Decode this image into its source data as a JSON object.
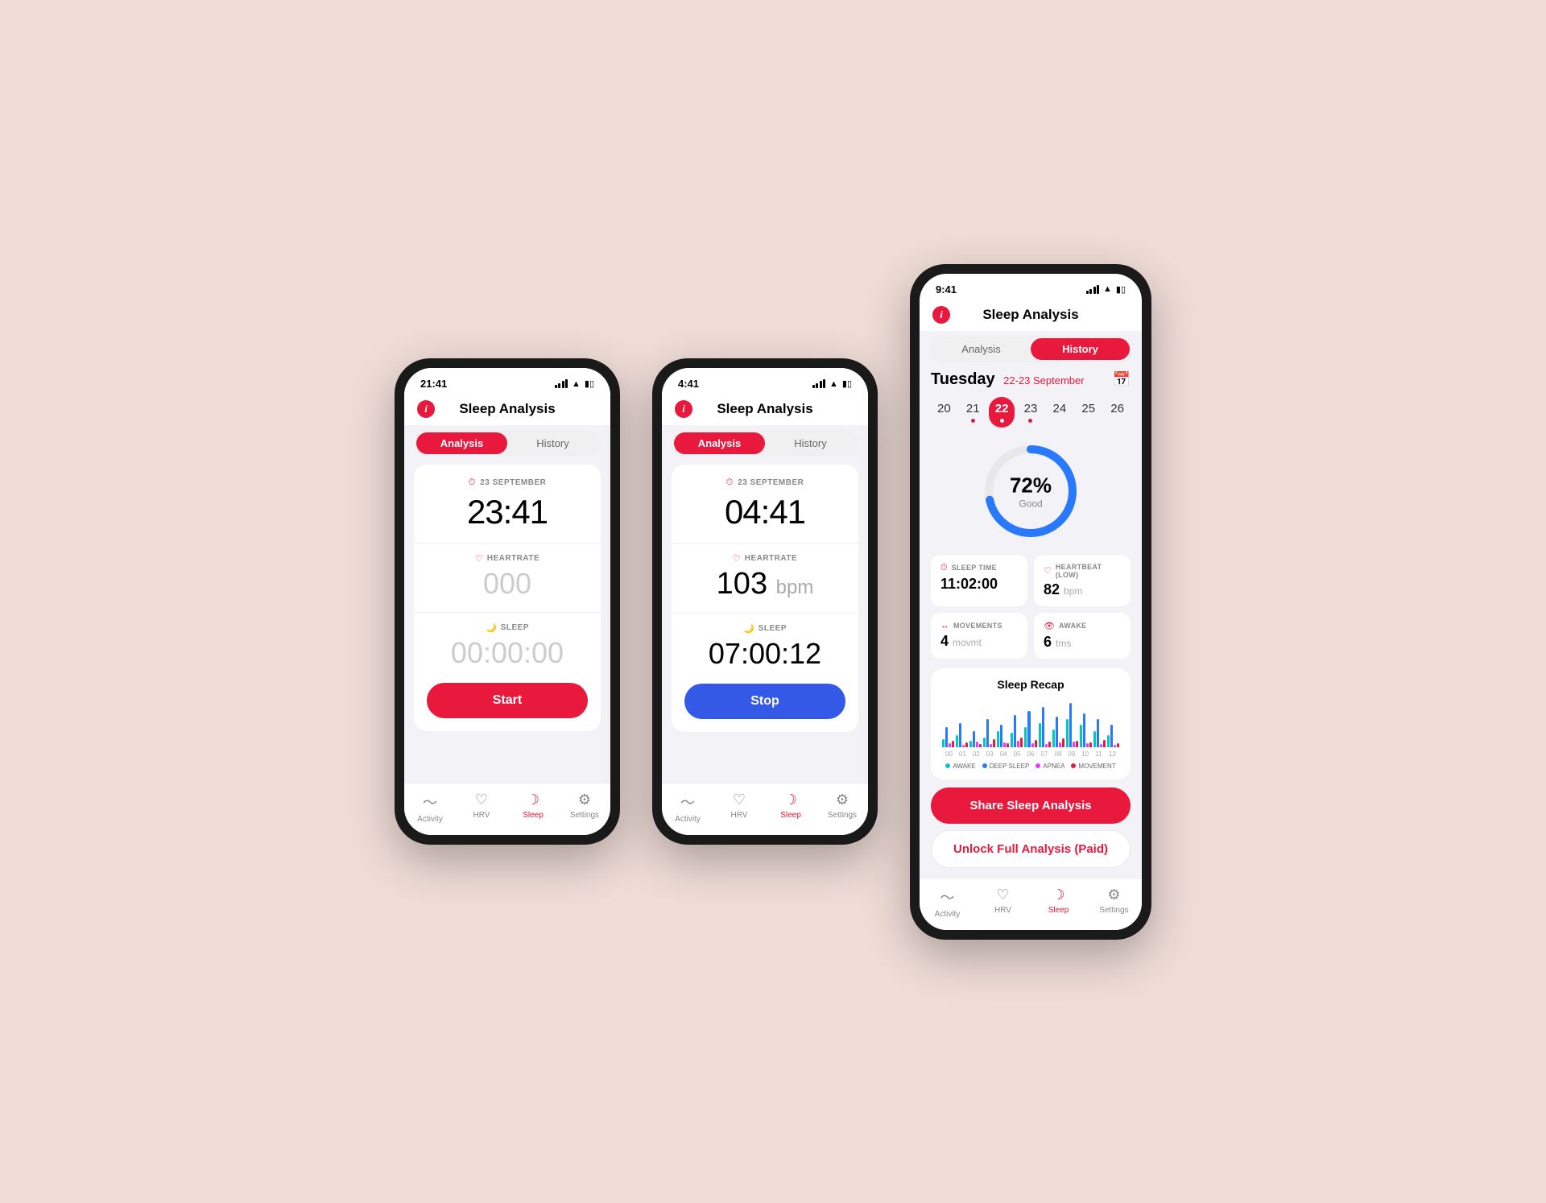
{
  "app": {
    "title": "Sleep Analysis",
    "info_label": "i"
  },
  "phone1": {
    "status_time": "21:41",
    "tab_analysis": "Analysis",
    "tab_history": "History",
    "active_tab": "analysis",
    "date_label": "23 SEPTEMBER",
    "big_time": "23:41",
    "hr_label": "HEARTRATE",
    "hr_value": "000",
    "sleep_label": "SLEEP",
    "sleep_value": "00:00:00",
    "start_btn": "Start",
    "nav": [
      {
        "label": "Activity",
        "icon": "activity"
      },
      {
        "label": "HRV",
        "icon": "hrv"
      },
      {
        "label": "Sleep",
        "icon": "sleep"
      },
      {
        "label": "Settings",
        "icon": "settings"
      }
    ],
    "active_nav": 2
  },
  "phone2": {
    "status_time": "4:41",
    "tab_analysis": "Analysis",
    "tab_history": "History",
    "active_tab": "analysis",
    "date_label": "23 SEPTEMBER",
    "big_time": "04:41",
    "hr_label": "HEARTRATE",
    "hr_value": "103",
    "hr_unit": "bpm",
    "sleep_label": "SLEEP",
    "sleep_value": "07:00:12",
    "stop_btn": "Stop",
    "nav": [
      {
        "label": "Activity",
        "icon": "activity"
      },
      {
        "label": "HRV",
        "icon": "hrv"
      },
      {
        "label": "Sleep",
        "icon": "sleep"
      },
      {
        "label": "Settings",
        "icon": "settings"
      }
    ],
    "active_nav": 2
  },
  "phone3": {
    "status_time": "9:41",
    "tab_analysis": "Analysis",
    "tab_history": "History",
    "active_tab": "history",
    "day_name": "Tuesday",
    "day_range": "22-23 September",
    "dates": [
      {
        "num": "20",
        "has_dot": false
      },
      {
        "num": "21",
        "has_dot": true
      },
      {
        "num": "22",
        "has_dot": true,
        "selected": true
      },
      {
        "num": "23",
        "has_dot": true
      },
      {
        "num": "24",
        "has_dot": false
      },
      {
        "num": "25",
        "has_dot": false
      },
      {
        "num": "26",
        "has_dot": false
      }
    ],
    "score_percent": "72%",
    "score_label": "Good",
    "stats": [
      {
        "icon": "clock",
        "label": "SLEEP TIME",
        "value": "11:02:00",
        "unit": ""
      },
      {
        "icon": "heart",
        "label": "HEARTBEAT (LOW)",
        "value": "82",
        "unit": "bpm"
      },
      {
        "icon": "movement",
        "label": "MOVEMENTS",
        "value": "4",
        "unit": "movmt"
      },
      {
        "icon": "awake",
        "label": "AWAKE",
        "value": "6",
        "unit": "tms"
      }
    ],
    "recap_title": "Sleep Recap",
    "x_labels": [
      "00",
      "01",
      "02",
      "03",
      "04",
      "05",
      "06",
      "07",
      "08",
      "09",
      "10",
      "11",
      "12"
    ],
    "chart_legend": [
      {
        "color": "#00c8c8",
        "label": "AWAKE"
      },
      {
        "color": "#2979ff",
        "label": "DEEP SLEEP"
      },
      {
        "color": "#e040fb",
        "label": "APNEA"
      },
      {
        "color": "#e8193c",
        "label": "MOVEMENT"
      }
    ],
    "share_btn": "Share Sleep Analysis",
    "unlock_btn": "Unlock Full Analysis (Paid)",
    "nav": [
      {
        "label": "Activity",
        "icon": "activity"
      },
      {
        "label": "HRV",
        "icon": "hrv"
      },
      {
        "label": "Sleep",
        "icon": "sleep"
      },
      {
        "label": "Settings",
        "icon": "settings"
      }
    ],
    "active_nav": 2,
    "chart_bars": [
      [
        10,
        25,
        5,
        8
      ],
      [
        15,
        30,
        3,
        6
      ],
      [
        8,
        20,
        7,
        4
      ],
      [
        12,
        35,
        4,
        10
      ],
      [
        20,
        28,
        6,
        5
      ],
      [
        18,
        40,
        8,
        12
      ],
      [
        25,
        45,
        5,
        9
      ],
      [
        30,
        50,
        4,
        7
      ],
      [
        22,
        38,
        6,
        11
      ],
      [
        35,
        55,
        7,
        8
      ],
      [
        28,
        42,
        5,
        6
      ],
      [
        20,
        35,
        4,
        9
      ],
      [
        15,
        28,
        3,
        5
      ]
    ]
  }
}
